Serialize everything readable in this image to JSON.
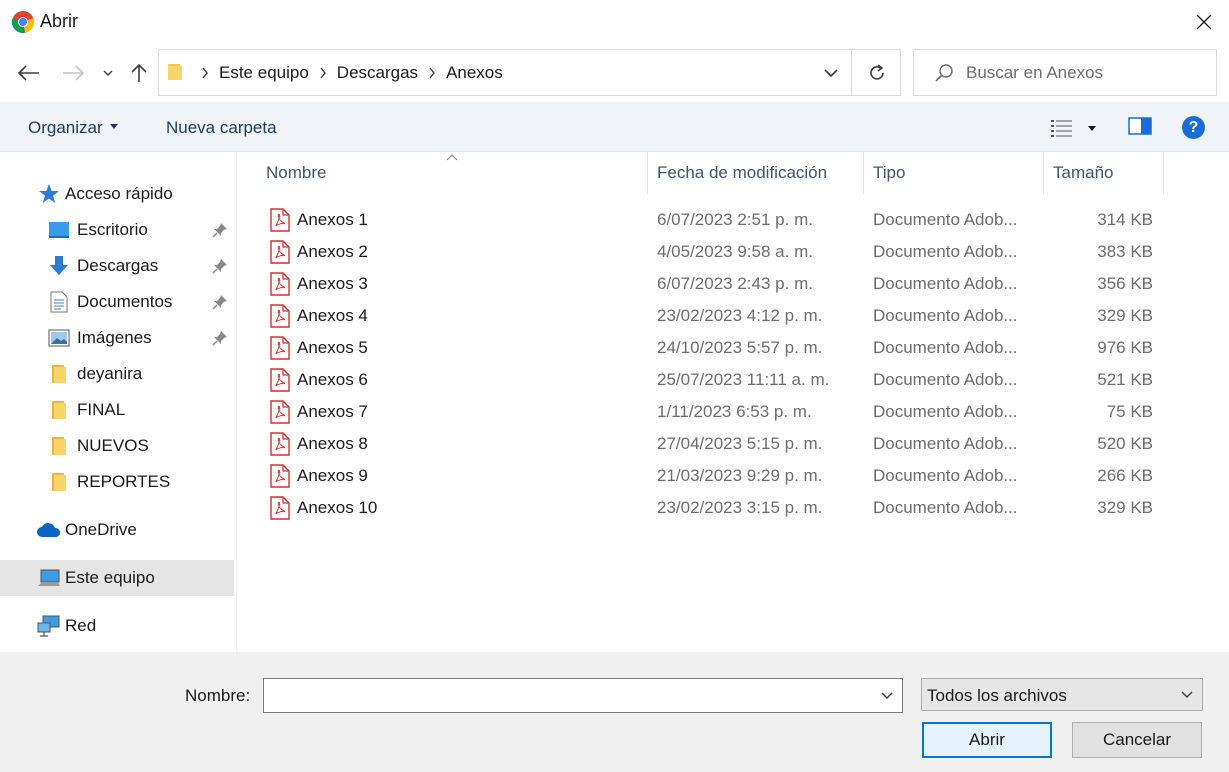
{
  "window": {
    "title": "Abrir"
  },
  "address": {
    "crumbs": [
      "Este equipo",
      "Descargas",
      "Anexos"
    ]
  },
  "search": {
    "placeholder": "Buscar en Anexos"
  },
  "toolbar": {
    "organize": "Organizar",
    "new_folder": "Nueva carpeta"
  },
  "nav": {
    "quick_access": "Acceso rápido",
    "items": [
      {
        "label": "Escritorio",
        "icon": "desktop-icon",
        "pinned": true
      },
      {
        "label": "Descargas",
        "icon": "download-icon",
        "pinned": true
      },
      {
        "label": "Documentos",
        "icon": "document-icon",
        "pinned": true
      },
      {
        "label": "Imágenes",
        "icon": "image-icon",
        "pinned": true
      },
      {
        "label": "deyanira",
        "icon": "folder-icon",
        "pinned": false
      },
      {
        "label": "FINAL",
        "icon": "folder-icon",
        "pinned": false
      },
      {
        "label": "NUEVOS",
        "icon": "folder-icon",
        "pinned": false
      },
      {
        "label": "REPORTES",
        "icon": "folder-icon",
        "pinned": false
      }
    ],
    "onedrive": "OneDrive",
    "this_pc": "Este equipo",
    "network": "Red"
  },
  "columns": {
    "name": "Nombre",
    "date": "Fecha de modificación",
    "type": "Tipo",
    "size": "Tamaño"
  },
  "files": [
    {
      "name": "Anexos 1",
      "date": "6/07/2023 2:51 p. m.",
      "type": "Documento Adob...",
      "size": "314 KB"
    },
    {
      "name": "Anexos 2",
      "date": "4/05/2023 9:58 a. m.",
      "type": "Documento Adob...",
      "size": "383 KB"
    },
    {
      "name": "Anexos 3",
      "date": "6/07/2023 2:43 p. m.",
      "type": "Documento Adob...",
      "size": "356 KB"
    },
    {
      "name": "Anexos 4",
      "date": "23/02/2023 4:12 p. m.",
      "type": "Documento Adob...",
      "size": "329 KB"
    },
    {
      "name": "Anexos 5",
      "date": "24/10/2023 5:57 p. m.",
      "type": "Documento Adob...",
      "size": "976 KB"
    },
    {
      "name": "Anexos 6",
      "date": "25/07/2023 11:11 a. m.",
      "type": "Documento Adob...",
      "size": "521 KB"
    },
    {
      "name": "Anexos 7",
      "date": "1/11/2023 6:53 p. m.",
      "type": "Documento Adob...",
      "size": "75 KB"
    },
    {
      "name": "Anexos 8",
      "date": "27/04/2023 5:15 p. m.",
      "type": "Documento Adob...",
      "size": "520 KB"
    },
    {
      "name": "Anexos 9",
      "date": "21/03/2023 9:29 p. m.",
      "type": "Documento Adob...",
      "size": "266 KB"
    },
    {
      "name": "Anexos 10",
      "date": "23/02/2023 3:15 p. m.",
      "type": "Documento Adob...",
      "size": "329 KB"
    }
  ],
  "footer": {
    "name_label": "Nombre:",
    "name_value": "",
    "filter": "Todos los archivos",
    "open": "Abrir",
    "cancel": "Cancelar"
  },
  "colors": {
    "accent": "#0078d7",
    "pdf_red": "#d32f2f",
    "folder": "#f3c74f"
  }
}
